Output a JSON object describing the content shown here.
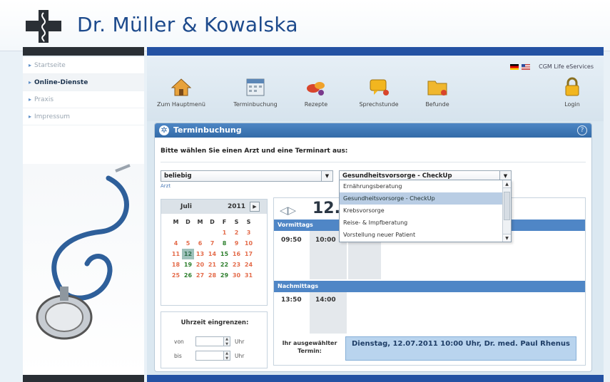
{
  "header": {
    "brand": "Dr. Müller & Kowalska"
  },
  "sidebar": {
    "items": [
      {
        "label": "Startseite"
      },
      {
        "label": "Online-Dienste"
      },
      {
        "label": "Praxis"
      },
      {
        "label": "Impressum"
      }
    ],
    "active_index": 1
  },
  "topbar": {
    "service_label": "CGM Life eServices"
  },
  "toolbar": {
    "items": [
      {
        "label": "Zum Hauptmenü",
        "icon": "house-icon"
      },
      {
        "label": "Terminbuchung",
        "icon": "calendar-icon"
      },
      {
        "label": "Rezepte",
        "icon": "pills-icon"
      },
      {
        "label": "Sprechstunde",
        "icon": "chat-icon"
      },
      {
        "label": "Befunde",
        "icon": "folder-icon"
      },
      {
        "label": "Login",
        "icon": "lock-icon"
      }
    ]
  },
  "panel": {
    "title": "Terminbuchung",
    "help": "?",
    "instruction": "Bitte wählen Sie einen Arzt und eine Terminart aus:",
    "doctor_select": {
      "value": "beliebig",
      "caption": "Arzt"
    },
    "type_select": {
      "value": "Gesundheitsvorsorge - CheckUp"
    },
    "type_options": [
      "Ernährungsberatung",
      "Gesundheitsvorsorge - CheckUp",
      "Krebsvorsorge",
      "Reise- & Impfberatung",
      "Vorstellung neuer Patient"
    ],
    "type_selected_index": 1
  },
  "calendar": {
    "month": "Juli",
    "year": "2011",
    "weekdays": [
      "M",
      "D",
      "M",
      "D",
      "F",
      "S",
      "S"
    ],
    "weeks": [
      [
        "",
        "",
        "",
        "",
        "1",
        "2",
        "3"
      ],
      [
        "4",
        "5",
        "6",
        "7",
        "8",
        "9",
        "10"
      ],
      [
        "11",
        "12",
        "13",
        "14",
        "15",
        "16",
        "17"
      ],
      [
        "18",
        "19",
        "20",
        "21",
        "22",
        "23",
        "24"
      ],
      [
        "25",
        "26",
        "27",
        "28",
        "29",
        "30",
        "31"
      ]
    ],
    "available_days": [
      "8",
      "12",
      "15",
      "19",
      "22",
      "26",
      "29"
    ],
    "selected_day": "12"
  },
  "time_filter": {
    "title": "Uhrzeit eingrenzen:",
    "from_label": "von",
    "to_label": "bis",
    "unit": "Uhr"
  },
  "day_view": {
    "date": "12.",
    "morning_label": "Vormittags",
    "morning_slots": [
      "09:50",
      "10:00"
    ],
    "afternoon_label": "Nachmittags",
    "afternoon_slots": [
      "13:50",
      "14:00"
    ],
    "summary_label": "Ihr ausgewählter Termin:",
    "summary_value": "Dienstag, 12.07.2011 10:00 Uhr, Dr. med. Paul Rhenus"
  },
  "colors": {
    "brand": "#1d4a8c",
    "accent": "#2452a3",
    "available": "#2d7f2d",
    "unavailable": "#e46c4b"
  }
}
